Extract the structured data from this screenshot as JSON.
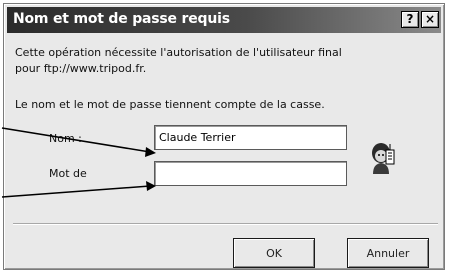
{
  "dialog": {
    "title": "Nom et mot de passe requis",
    "help_button": "?",
    "close_button": "×",
    "message_line1": "Cette opération nécessite l'autorisation de l'utilisateur final",
    "message_line2": "pour ftp://www.tripod.fr.",
    "case_note": "Le nom et le mot de passe tiennent compte de la casse.",
    "name_label": "Nom :",
    "name_value": "Claude Terrier",
    "password_label": "Mot de",
    "password_value": "",
    "icon": "keys-person-icon",
    "ok_label": "OK",
    "cancel_label": "Annuler"
  }
}
